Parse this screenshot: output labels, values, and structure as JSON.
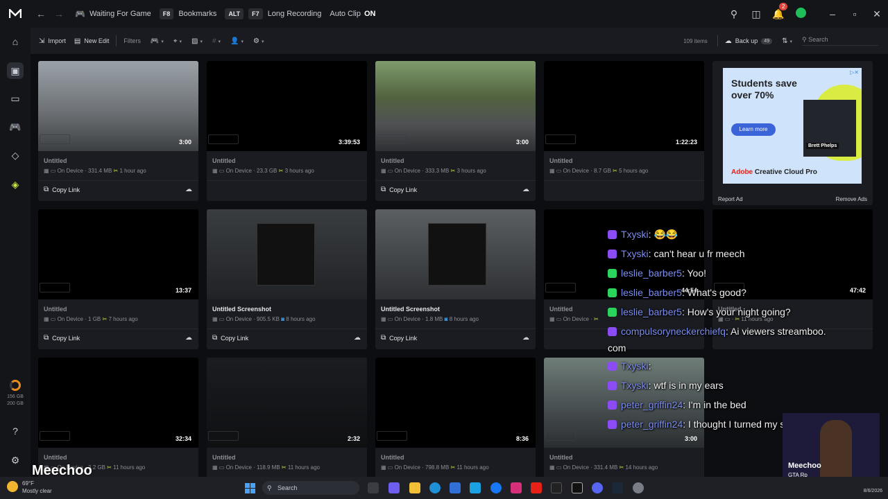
{
  "titlebar": {
    "status_label": "Waiting For Game",
    "bookmarks_key": "F8",
    "bookmarks_label": "Bookmarks",
    "alt_key": "ALT",
    "long_recording_key": "F7",
    "long_recording_label": "Long Recording",
    "auto_clip_label": "Auto Clip",
    "auto_clip_value": "ON",
    "notification_count": "2"
  },
  "toolbar": {
    "import_label": "Import",
    "new_edit_label": "New Edit",
    "filters_label": "Filters",
    "items_count": "109 items",
    "backup_label": "Back up",
    "backup_count": "49",
    "search_placeholder": "Search"
  },
  "sidebar": {
    "storage_used": "156 GB",
    "storage_total": "200 GB"
  },
  "cards": [
    {
      "duration": "3:00",
      "title": "Untitled",
      "location": "On Device",
      "size": "331.4 MB",
      "time": "1 hour ago",
      "copy_link": "Copy Link"
    },
    {
      "duration": "3:39:53",
      "title": "Untitled",
      "location": "On Device",
      "size": "23.3 GB",
      "time": "3 hours ago",
      "copy_link": ""
    },
    {
      "duration": "3:00",
      "title": "Untitled",
      "location": "On Device",
      "size": "333.3 MB",
      "time": "3 hours ago",
      "copy_link": "Copy Link"
    },
    {
      "duration": "1:22:23",
      "title": "Untitled",
      "location": "On Device",
      "size": "8.7 GB",
      "time": "5 hours ago",
      "copy_link": ""
    },
    {
      "duration": "13:37",
      "title": "Untitled",
      "location": "On Device",
      "size": "1 GB",
      "time": "7 hours ago",
      "copy_link": "Copy Link"
    },
    {
      "duration": "",
      "title": "Untitled Screenshot",
      "location": "On Device",
      "size": "905.5 KB",
      "time": "8 hours ago",
      "copy_link": "Copy Link"
    },
    {
      "duration": "",
      "title": "Untitled Screenshot",
      "location": "On Device",
      "size": "1.8 MB",
      "time": "8 hours ago",
      "copy_link": "Copy Link"
    },
    {
      "duration": "44:54",
      "title": "Untitled",
      "location": "On Device",
      "size": "",
      "time": "",
      "copy_link": ""
    },
    {
      "duration": "47:42",
      "title": "Untitled",
      "location": "",
      "size": "",
      "time": "11 hours ago",
      "copy_link": ""
    },
    {
      "duration": "32:34",
      "title": "Untitled",
      "location": "On Device",
      "size": "3.2 GB",
      "time": "11 hours ago",
      "copy_link": ""
    },
    {
      "duration": "2:32",
      "title": "Untitled",
      "location": "On Device",
      "size": "118.9 MB",
      "time": "11 hours ago",
      "copy_link": ""
    },
    {
      "duration": "8:36",
      "title": "Untitled",
      "location": "On Device",
      "size": "798.8 MB",
      "time": "11 hours ago",
      "copy_link": ""
    },
    {
      "duration": "3:00",
      "title": "Untitled",
      "location": "On Device",
      "size": "331.4 MB",
      "time": "14 hours ago",
      "copy_link": ""
    }
  ],
  "ad": {
    "headline_1": "Students save",
    "headline_2": "over 70%",
    "cta": "Learn more",
    "person_name": "Brett Phelps",
    "brand": "Adobe",
    "product": "Creative Cloud Pro",
    "report_label": "Report Ad",
    "remove_label": "Remove Ads"
  },
  "chat": [
    {
      "user": "Txyski",
      "message": "😂😂",
      "platform": "twitch"
    },
    {
      "user": "Txyski",
      "message": "can't hear u fr meech",
      "platform": "twitch"
    },
    {
      "user": "leslie_barber5",
      "message": "Yoo!",
      "platform": "kick"
    },
    {
      "user": "leslie_barber5",
      "message": "What's good?",
      "platform": "kick"
    },
    {
      "user": "leslie_barber5",
      "message": "How's your night going?",
      "platform": "kick"
    },
    {
      "user": "compulsoryneckerchiefq",
      "message": "Ai viewers streamboo.",
      "platform": "twitch"
    },
    {
      "user": "",
      "message": "com",
      "platform": ""
    },
    {
      "user": "Txyski",
      "message": "",
      "platform": "twitch"
    },
    {
      "user": "Txyski",
      "message": "wtf is in my ears",
      "platform": "twitch"
    },
    {
      "user": "peter_griffin24",
      "message": "I'm in the bed",
      "platform": "twitch"
    },
    {
      "user": "peter_griffin24",
      "message": "I thought I turned my shit off",
      "platform": "twitch"
    }
  ],
  "stream": {
    "streamer_name": "Meechoo",
    "webcam_name": "Meechoo",
    "webcam_sub": "GTA Rp"
  },
  "taskbar": {
    "temperature": "69°F",
    "weather": "Mostly clear",
    "search_label": "Search",
    "date": "8/6/2026"
  },
  "colors": {
    "accent_green": "#1fbe58",
    "orange_storage": "#e58a23",
    "twitch_purple": "#8b4cf5",
    "kick_green": "#2bd45d"
  }
}
